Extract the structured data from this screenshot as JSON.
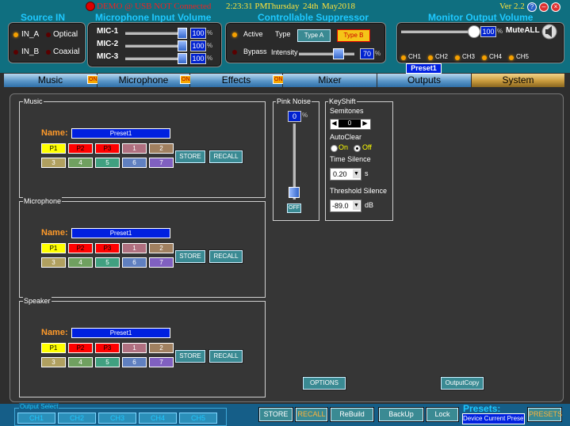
{
  "status": {
    "demo_text": "DEMO @ USB NOT Connected",
    "time": "2:23:31 PM",
    "day": "Thursday",
    "date": "24th",
    "month": "May",
    "year": "2018",
    "version": "Ver 2.2"
  },
  "source_input": {
    "title": "Source IN",
    "inputs": [
      {
        "label": "IN_A",
        "active": true
      },
      {
        "label": "Optical",
        "active": false
      },
      {
        "label": "IN_B",
        "active": false
      },
      {
        "label": "Coaxial",
        "active": false
      }
    ]
  },
  "mic_volume": {
    "title": "Microphone Input Volume",
    "unit": "%",
    "channels": [
      {
        "label": "MIC-1",
        "value": "100",
        "level": 1.0
      },
      {
        "label": "MIC-2",
        "value": "100",
        "level": 1.0
      },
      {
        "label": "MIC-3",
        "value": "100",
        "level": 1.0
      }
    ]
  },
  "feedback": {
    "title": "Controllable Suppressor",
    "active_label": "Active",
    "bypass_label": "Bypass",
    "type_label": "Type",
    "type_a": "Type A",
    "type_b": "Type B",
    "intensity_label": "Intensity",
    "intensity_value": "70",
    "intensity_level": 0.7,
    "unit": "%"
  },
  "monitor": {
    "title": "Monitor Output Volume",
    "value": "100",
    "level": 1.0,
    "unit": "%",
    "mute_label": "MuteALL",
    "channels": [
      "CH1",
      "CH2",
      "CH3",
      "CH4",
      "CH5"
    ],
    "preset_label": "Preset1"
  },
  "tabs": [
    {
      "label": "Music",
      "badge": "ON"
    },
    {
      "label": "Microphone",
      "badge": "ON"
    },
    {
      "label": "Effects",
      "badge": "ON"
    },
    {
      "label": "Mixer",
      "badge": ""
    },
    {
      "label": "Outputs",
      "badge": ""
    },
    {
      "label": "System",
      "badge": "",
      "selected": true
    }
  ],
  "groups": [
    {
      "title": "Music",
      "name_label": "Name:",
      "name_value": "Preset1"
    },
    {
      "title": "Microphone",
      "name_label": "Name:",
      "name_value": "Preset1"
    },
    {
      "title": "Speaker",
      "name_label": "Name:",
      "name_value": "Preset1"
    }
  ],
  "preset_buttons_row1": [
    "P1",
    "P2",
    "P3",
    "1",
    "2"
  ],
  "preset_buttons_row2": [
    "3",
    "4",
    "5",
    "6",
    "7"
  ],
  "store_label": "STORE",
  "recall_label": "RECALL",
  "pink_noise": {
    "title": "Pink Noise",
    "value": "0",
    "unit": "%",
    "level": 0.0,
    "off_label": "OFF"
  },
  "keyshift": {
    "title": "KeyShift",
    "semitones_label": "Semitones",
    "semitones_value": "0",
    "autoclear_label": "AutoClear",
    "on_label": "On",
    "off_label": "Off",
    "time_silence_label": "Time Silence",
    "time_silence_value": "0.20",
    "time_unit": "s",
    "threshold_label": "Threshold Silence",
    "threshold_value": "-89.0",
    "threshold_unit": "dB"
  },
  "options_label": "OPTIONS",
  "output_copy_label": "OutputCopy",
  "bottom": {
    "output_select_label": "Output Select",
    "channels": [
      "CH1",
      "CH2",
      "CH3",
      "CH4",
      "CH5"
    ],
    "store": "STORE",
    "recall": "RECALL",
    "rebuild": "ReBuild",
    "backup": "BackUp",
    "lock": "Lock",
    "presets_label": "Presets:",
    "device_preset": "Device Current Preset",
    "presets_button": "PRESETS"
  }
}
